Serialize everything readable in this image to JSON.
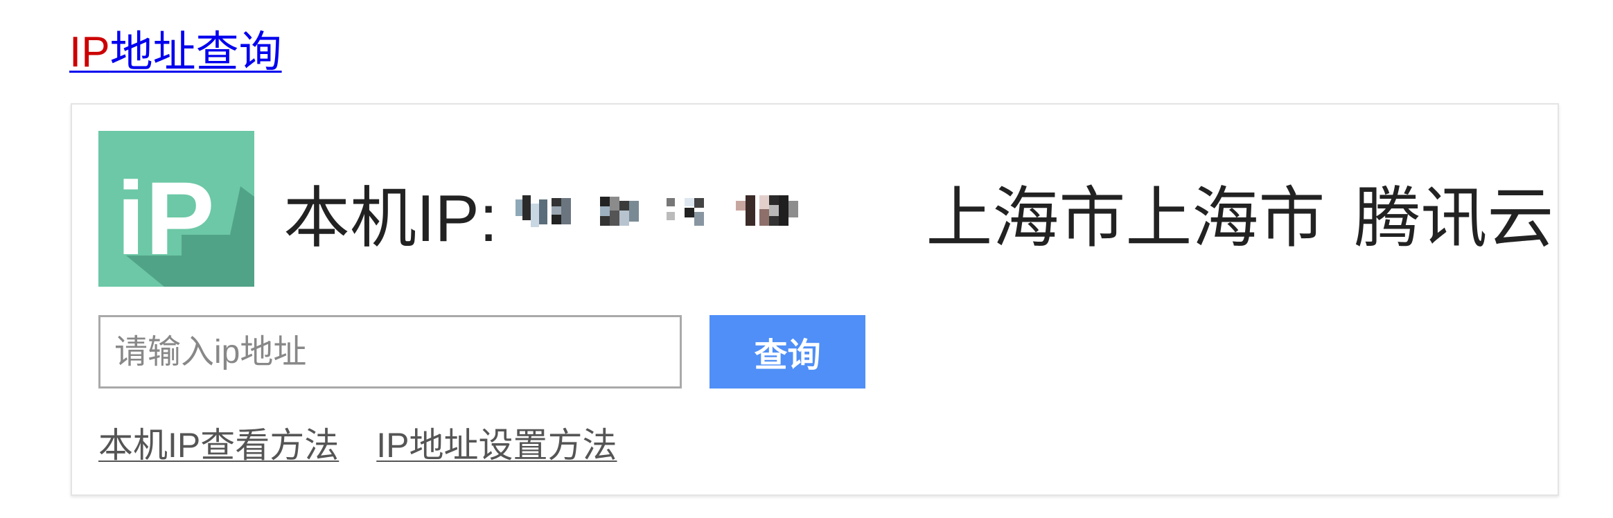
{
  "title": {
    "accent": "IP",
    "rest": "地址查询"
  },
  "widget": {
    "logo_text": "iP",
    "ip_label": "本机IP:",
    "location": "上海市上海市",
    "isp": "腾讯云",
    "search": {
      "placeholder": "请输入ip地址",
      "value": ""
    },
    "query_button": "查询",
    "links": [
      {
        "label": "本机IP查看方法"
      },
      {
        "label": "IP地址设置方法"
      }
    ]
  },
  "colors": {
    "logo_bg": "#6cc8a6",
    "logo_shadow": "#4c9c83",
    "button_bg": "#4f8ff7",
    "title_accent": "#cc0000",
    "title_link": "#0000ee"
  }
}
